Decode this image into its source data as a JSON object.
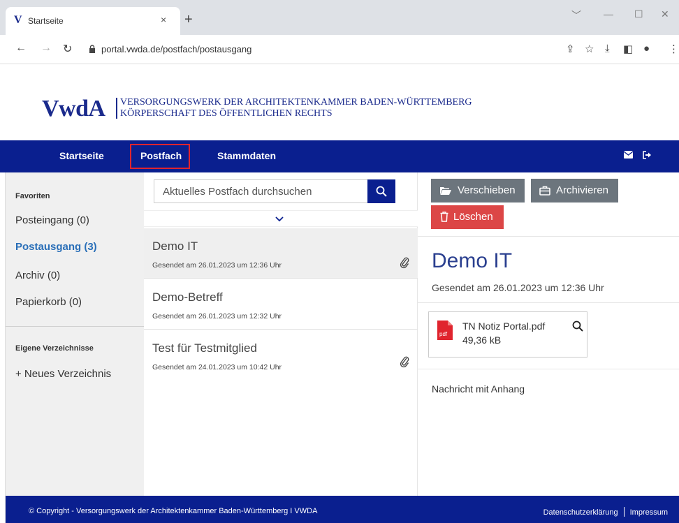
{
  "browser": {
    "tab_title": "Startseite",
    "tab_favicon": "V",
    "tab_close": "×",
    "new_tab": "+",
    "url": "portal.vwda.de/postfach/postausgang",
    "window_controls": [
      "﹀",
      "—",
      "☐",
      "✕"
    ]
  },
  "logo": {
    "mark": "VwdA",
    "line1": "VERSORGUNGSWERK DER ARCHITEKTENKAMMER BADEN-WÜRTTEMBERG",
    "line2": "KÖRPERSCHAFT DES ÖFFENTLICHEN RECHTS"
  },
  "nav": {
    "items": [
      "Startseite",
      "Postfach",
      "Stammdaten"
    ],
    "active": "Postfach",
    "icons": [
      "envelope-icon",
      "logout-icon"
    ]
  },
  "sidebar": {
    "favorites_heading": "Favoriten",
    "items": [
      {
        "label": "Posteingang (0)",
        "active": false
      },
      {
        "label": "Postausgang (3)",
        "active": true
      },
      {
        "label": "Archiv (0)",
        "active": false
      },
      {
        "label": "Papierkorb (0)",
        "active": false
      }
    ],
    "own_dirs_heading": "Eigene Verzeichnisse",
    "new_dir_label": "+  Neues Verzeichnis"
  },
  "list": {
    "search_placeholder": "Aktuelles Postfach durchsuchen",
    "messages": [
      {
        "title": "Demo IT",
        "date": "Gesendet am 26.01.2023 um 12:36 Uhr",
        "attachment": true,
        "selected": true
      },
      {
        "title": "Demo-Betreff",
        "date": "Gesendet am 26.01.2023 um 12:32 Uhr",
        "attachment": false,
        "selected": false
      },
      {
        "title": "Test für Testmitglied",
        "date": "Gesendet am 24.01.2023 um 10:42 Uhr",
        "attachment": true,
        "selected": false
      }
    ]
  },
  "detail": {
    "buttons": {
      "move": "Verschieben",
      "archive": "Archivieren",
      "delete": "Löschen"
    },
    "title": "Demo IT",
    "date": "Gesendet am 26.01.2023 um 12:36 Uhr",
    "attachment": {
      "name": "TN Notiz Portal.pdf",
      "size": "49,36 kB",
      "icon_label": "pdf"
    },
    "body": "Nachricht mit Anhang"
  },
  "footer": {
    "copyright": "© Copyright - Versorgungswerk der Architektenkammer Baden-Württemberg I VWDA",
    "privacy": "Datenschutzerklärung",
    "imprint": "Impressum"
  },
  "colors": {
    "brand_blue": "#0a1f8f",
    "active_link": "#2a6fb8",
    "danger": "#dc4646",
    "secondary": "#6c757d",
    "highlight_box": "#e0242e"
  }
}
